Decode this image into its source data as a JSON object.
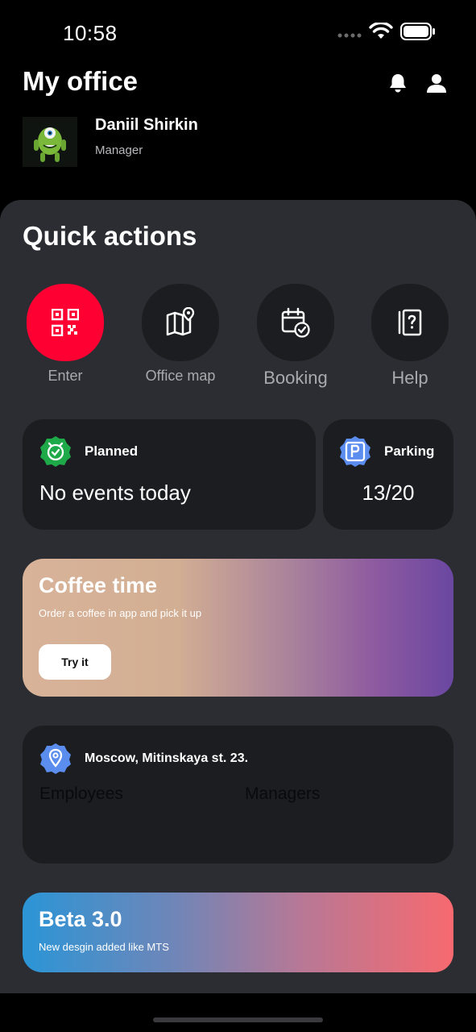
{
  "status_bar": {
    "time": "10:58"
  },
  "header": {
    "title": "My office"
  },
  "user": {
    "name": "Daniil Shirkin",
    "role": "Manager"
  },
  "quick_actions": {
    "title": "Quick actions",
    "items": [
      {
        "label": "Enter",
        "icon": "qr-code-icon"
      },
      {
        "label": "Office map",
        "icon": "map-pin-icon"
      },
      {
        "label": "Booking",
        "icon": "calendar-check-icon"
      },
      {
        "label": "Help",
        "icon": "help-book-icon"
      }
    ]
  },
  "planned": {
    "title": "Planned",
    "text": "No events today"
  },
  "parking": {
    "title": "Parking",
    "value": "13/20"
  },
  "coffee": {
    "title": "Coffee time",
    "subtitle": "Order a coffee in app and pick it up",
    "button": "Try it"
  },
  "office": {
    "address": "Moscow, Mitinskaya st. 23.",
    "employees_label": "Employees",
    "managers_label": "Managers"
  },
  "beta": {
    "title": "Beta 3.0",
    "subtitle": "New desgin added like MTS"
  },
  "colors": {
    "accent_red": "#ff0032",
    "sheet": "#2c2d32",
    "card": "#1c1d21",
    "planned_green": "#1faa4a",
    "parking_blue": "#5b8def"
  }
}
